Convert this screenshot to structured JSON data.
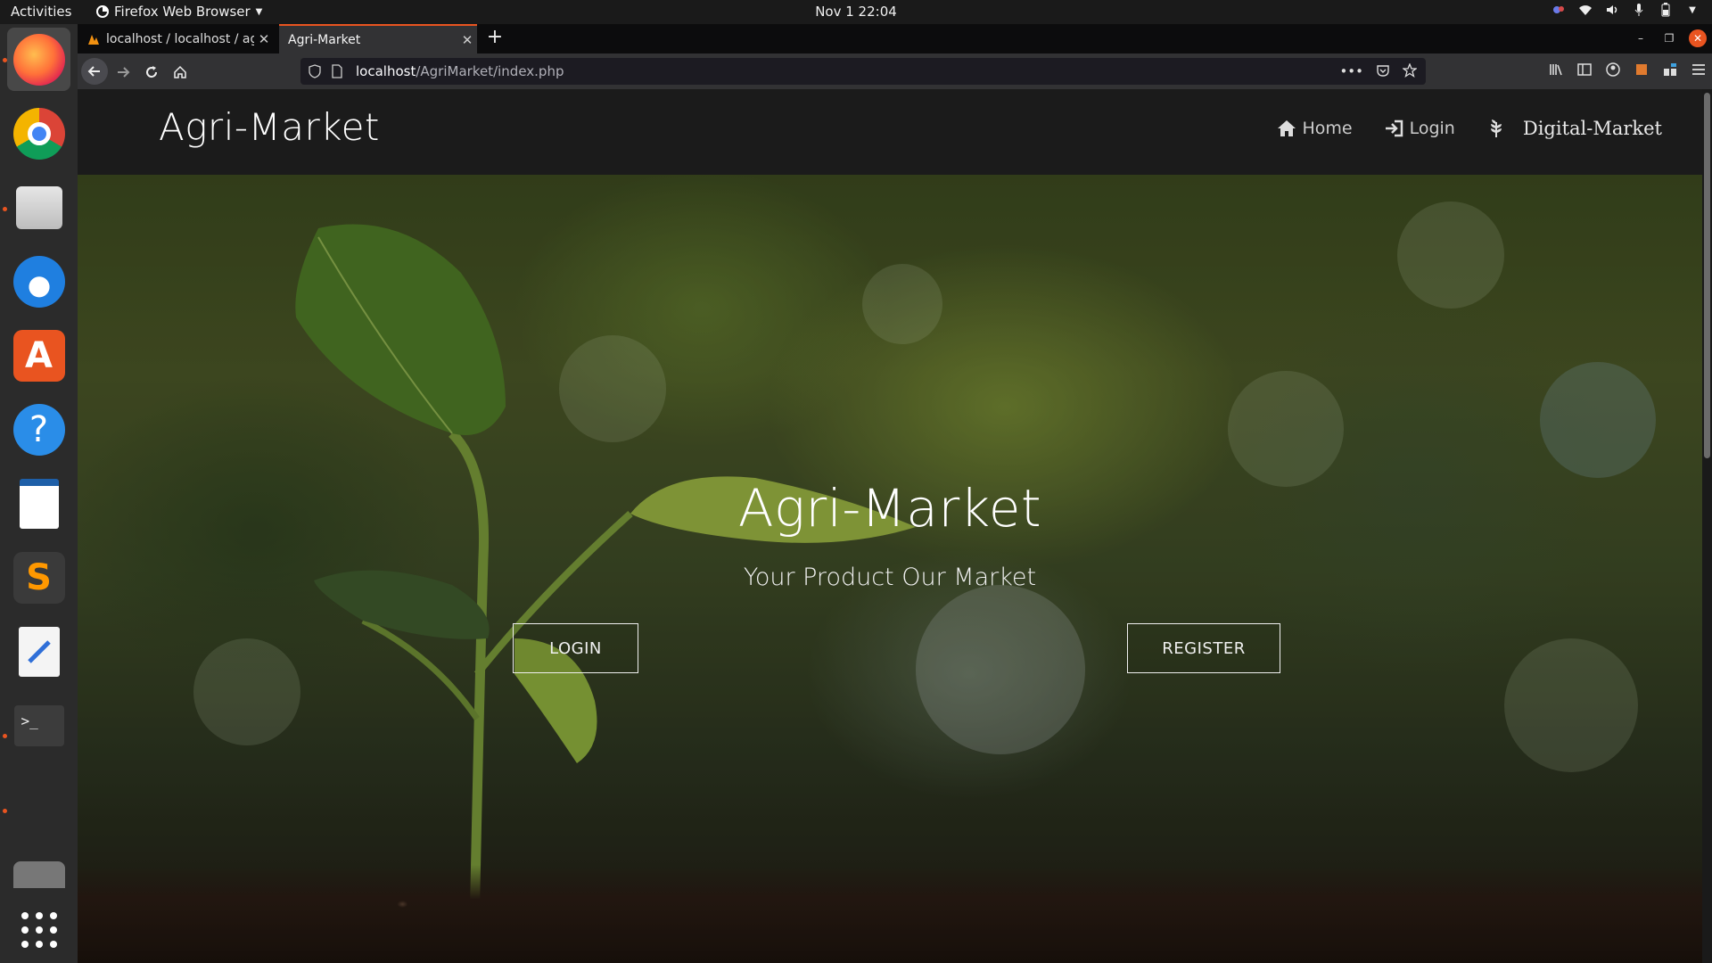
{
  "topbar": {
    "activities": "Activities",
    "app_name": "Firefox Web Browser",
    "clock": "Nov 1  22:04"
  },
  "dock": {
    "apps": [
      "firefox",
      "chrome",
      "files",
      "thunderbird",
      "ubuntu-software",
      "help",
      "libreoffice-impress",
      "sublime-text",
      "text-editor",
      "terminal",
      "screenshot",
      "show-applications"
    ]
  },
  "browser": {
    "tabs": [
      {
        "title": "localhost / localhost / ag",
        "active": false
      },
      {
        "title": "Agri-Market",
        "active": true
      }
    ],
    "url_host": "localhost",
    "url_path": "/AgriMarket/index.php"
  },
  "site": {
    "brand": "Agri-Market",
    "menu": {
      "home": "Home",
      "login": "Login",
      "digital": "Digital-Market"
    }
  },
  "hero": {
    "title": "Agri-Market",
    "subtitle": "Your Product Our Market",
    "login_label": "LOGIN",
    "register_label": "REGISTER"
  },
  "colors": {
    "accent": "#e95420",
    "nav_bg": "#1b1b1b"
  }
}
